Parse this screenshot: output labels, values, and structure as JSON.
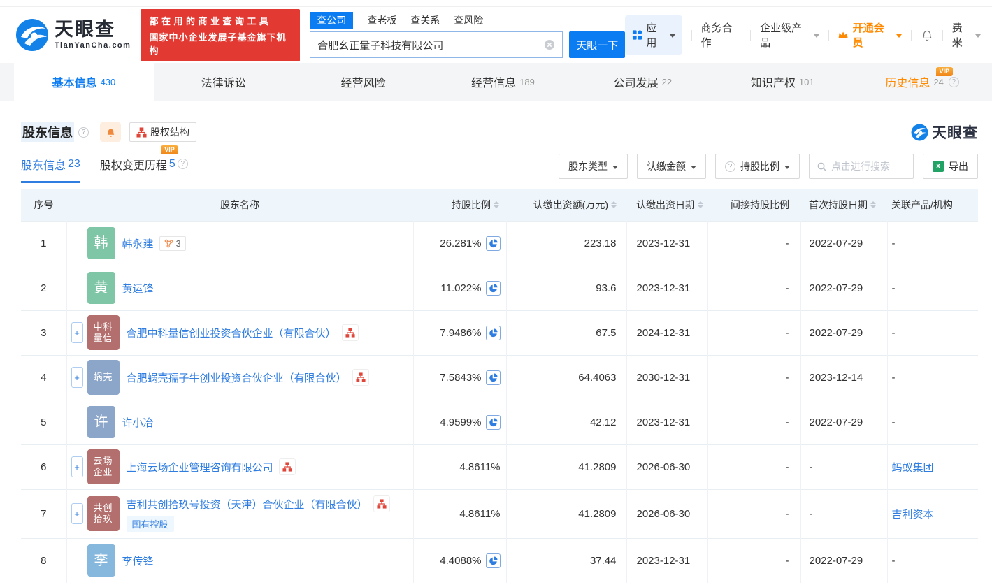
{
  "colors": {
    "primary_blue": "#0b7cf2",
    "link_blue": "#2f7de0",
    "vip_orange": "#ff8a00",
    "banner_red": "#e23a33",
    "org_icon_red": "#e0453a",
    "table_header_bg": "#eef5fb"
  },
  "header": {
    "logo": {
      "title": "天眼查",
      "subtitle": "TianYanCha.com"
    },
    "banner": {
      "line1": "都在用的商业查询工具",
      "line2": "国家中小企业发展子基金旗下机构"
    },
    "search": {
      "tabs": [
        {
          "label": "查公司",
          "active": true
        },
        {
          "label": "查老板",
          "active": false
        },
        {
          "label": "查关系",
          "active": false
        },
        {
          "label": "查风险",
          "active": false
        }
      ],
      "value": "合肥幺正量子科技有限公司",
      "button": "天眼一下"
    },
    "nav": {
      "apps": "应用",
      "business": "商务合作",
      "enterprise": "企业级产品",
      "vip": "开通会员",
      "user": "费米"
    }
  },
  "company_tabs": [
    {
      "label": "基本信息",
      "count": "430",
      "active": true,
      "vip": false,
      "help": false
    },
    {
      "label": "法律诉讼",
      "count": "",
      "active": false,
      "vip": false,
      "help": false
    },
    {
      "label": "经营风险",
      "count": "",
      "active": false,
      "vip": false,
      "help": false
    },
    {
      "label": "经营信息",
      "count": "189",
      "active": false,
      "vip": false,
      "help": false
    },
    {
      "label": "公司发展",
      "count": "22",
      "active": false,
      "vip": false,
      "help": false
    },
    {
      "label": "知识产权",
      "count": "101",
      "active": false,
      "vip": false,
      "help": false
    },
    {
      "label": "历史信息",
      "count": "24",
      "active": false,
      "vip": true,
      "help": true
    }
  ],
  "vip_badge_label": "VIP",
  "section": {
    "title": "股东信息",
    "structure_button": "股权结构",
    "watermark": "天眼查",
    "subtabs": [
      {
        "label": "股东信息",
        "count": "23",
        "active": true,
        "vip": false,
        "help": false
      },
      {
        "label": "股权变更历程",
        "count": "5",
        "active": false,
        "vip": true,
        "help": true
      }
    ],
    "filters": {
      "shareholder_type": "股东类型",
      "subscribed_amount": "认缴金额",
      "share_ratio": "持股比例",
      "search_placeholder": "点击进行搜索",
      "export_label": "导出"
    }
  },
  "table": {
    "columns": [
      {
        "label": "序号",
        "sortable": false
      },
      {
        "label": "股东名称",
        "sortable": false
      },
      {
        "label": "持股比例",
        "sortable": true
      },
      {
        "label": "认缴出资额(万元)",
        "sortable": true
      },
      {
        "label": "认缴出资日期",
        "sortable": true
      },
      {
        "label": "间接持股比例",
        "sortable": false
      },
      {
        "label": "首次持股日期",
        "sortable": true
      },
      {
        "label": "关联产品/机构",
        "sortable": false
      }
    ],
    "rows": [
      {
        "no": "1",
        "avatar_lines": [
          "韩"
        ],
        "avatar_color": "#7fc6a6",
        "company": false,
        "name": "韩永建",
        "relation_count": "3",
        "tag": "",
        "ratio": "26.281%",
        "pie": true,
        "amount": "223.18",
        "pay_date": "2023-12-31",
        "indirect": "-",
        "first_date": "2022-07-29",
        "related": "-",
        "related_is_link": false
      },
      {
        "no": "2",
        "avatar_lines": [
          "黄"
        ],
        "avatar_color": "#7fc6a6",
        "company": false,
        "name": "黄运锋",
        "relation_count": "",
        "tag": "",
        "ratio": "11.022%",
        "pie": true,
        "amount": "93.6",
        "pay_date": "2023-12-31",
        "indirect": "-",
        "first_date": "2022-07-29",
        "related": "-",
        "related_is_link": false
      },
      {
        "no": "3",
        "avatar_lines": [
          "中科",
          "量信"
        ],
        "avatar_color": "#b26f6d",
        "company": true,
        "name": "合肥中科量信创业投资合伙企业（有限合伙）",
        "relation_count": "",
        "tag": "",
        "ratio": "7.9486%",
        "pie": true,
        "amount": "67.5",
        "pay_date": "2024-12-31",
        "indirect": "-",
        "first_date": "2022-07-29",
        "related": "-",
        "related_is_link": false
      },
      {
        "no": "4",
        "avatar_lines": [
          "蜗壳"
        ],
        "avatar_color": "#8ba6c9",
        "company": true,
        "name": "合肥蜗壳孺子牛创业投资合伙企业（有限合伙）",
        "relation_count": "",
        "tag": "",
        "ratio": "7.5843%",
        "pie": true,
        "amount": "64.4063",
        "pay_date": "2030-12-31",
        "indirect": "-",
        "first_date": "2023-12-14",
        "related": "-",
        "related_is_link": false
      },
      {
        "no": "5",
        "avatar_lines": [
          "许"
        ],
        "avatar_color": "#8ba6c9",
        "company": false,
        "name": "许小冶",
        "relation_count": "",
        "tag": "",
        "ratio": "4.9599%",
        "pie": true,
        "amount": "42.12",
        "pay_date": "2023-12-31",
        "indirect": "-",
        "first_date": "2022-07-29",
        "related": "-",
        "related_is_link": false
      },
      {
        "no": "6",
        "avatar_lines": [
          "云场",
          "企业"
        ],
        "avatar_color": "#b26f6d",
        "company": true,
        "name": "上海云场企业管理咨询有限公司",
        "relation_count": "",
        "tag": "",
        "ratio": "4.8611%",
        "pie": false,
        "amount": "41.2809",
        "pay_date": "2026-06-30",
        "indirect": "-",
        "first_date": "-",
        "related": "蚂蚁集团",
        "related_is_link": true
      },
      {
        "no": "7",
        "avatar_lines": [
          "共创",
          "拾玖"
        ],
        "avatar_color": "#b26f6d",
        "company": true,
        "name": "吉利共创拾玖号投资（天津）合伙企业（有限合伙）",
        "relation_count": "",
        "tag": "国有控股",
        "ratio": "4.8611%",
        "pie": false,
        "amount": "41.2809",
        "pay_date": "2026-06-30",
        "indirect": "-",
        "first_date": "-",
        "related": "吉利资本",
        "related_is_link": true
      },
      {
        "no": "8",
        "avatar_lines": [
          "李"
        ],
        "avatar_color": "#85b8dc",
        "company": false,
        "name": "李传锋",
        "relation_count": "",
        "tag": "",
        "ratio": "4.4088%",
        "pie": true,
        "amount": "37.44",
        "pay_date": "2023-12-31",
        "indirect": "-",
        "first_date": "2022-07-29",
        "related": "-",
        "related_is_link": false
      }
    ]
  }
}
